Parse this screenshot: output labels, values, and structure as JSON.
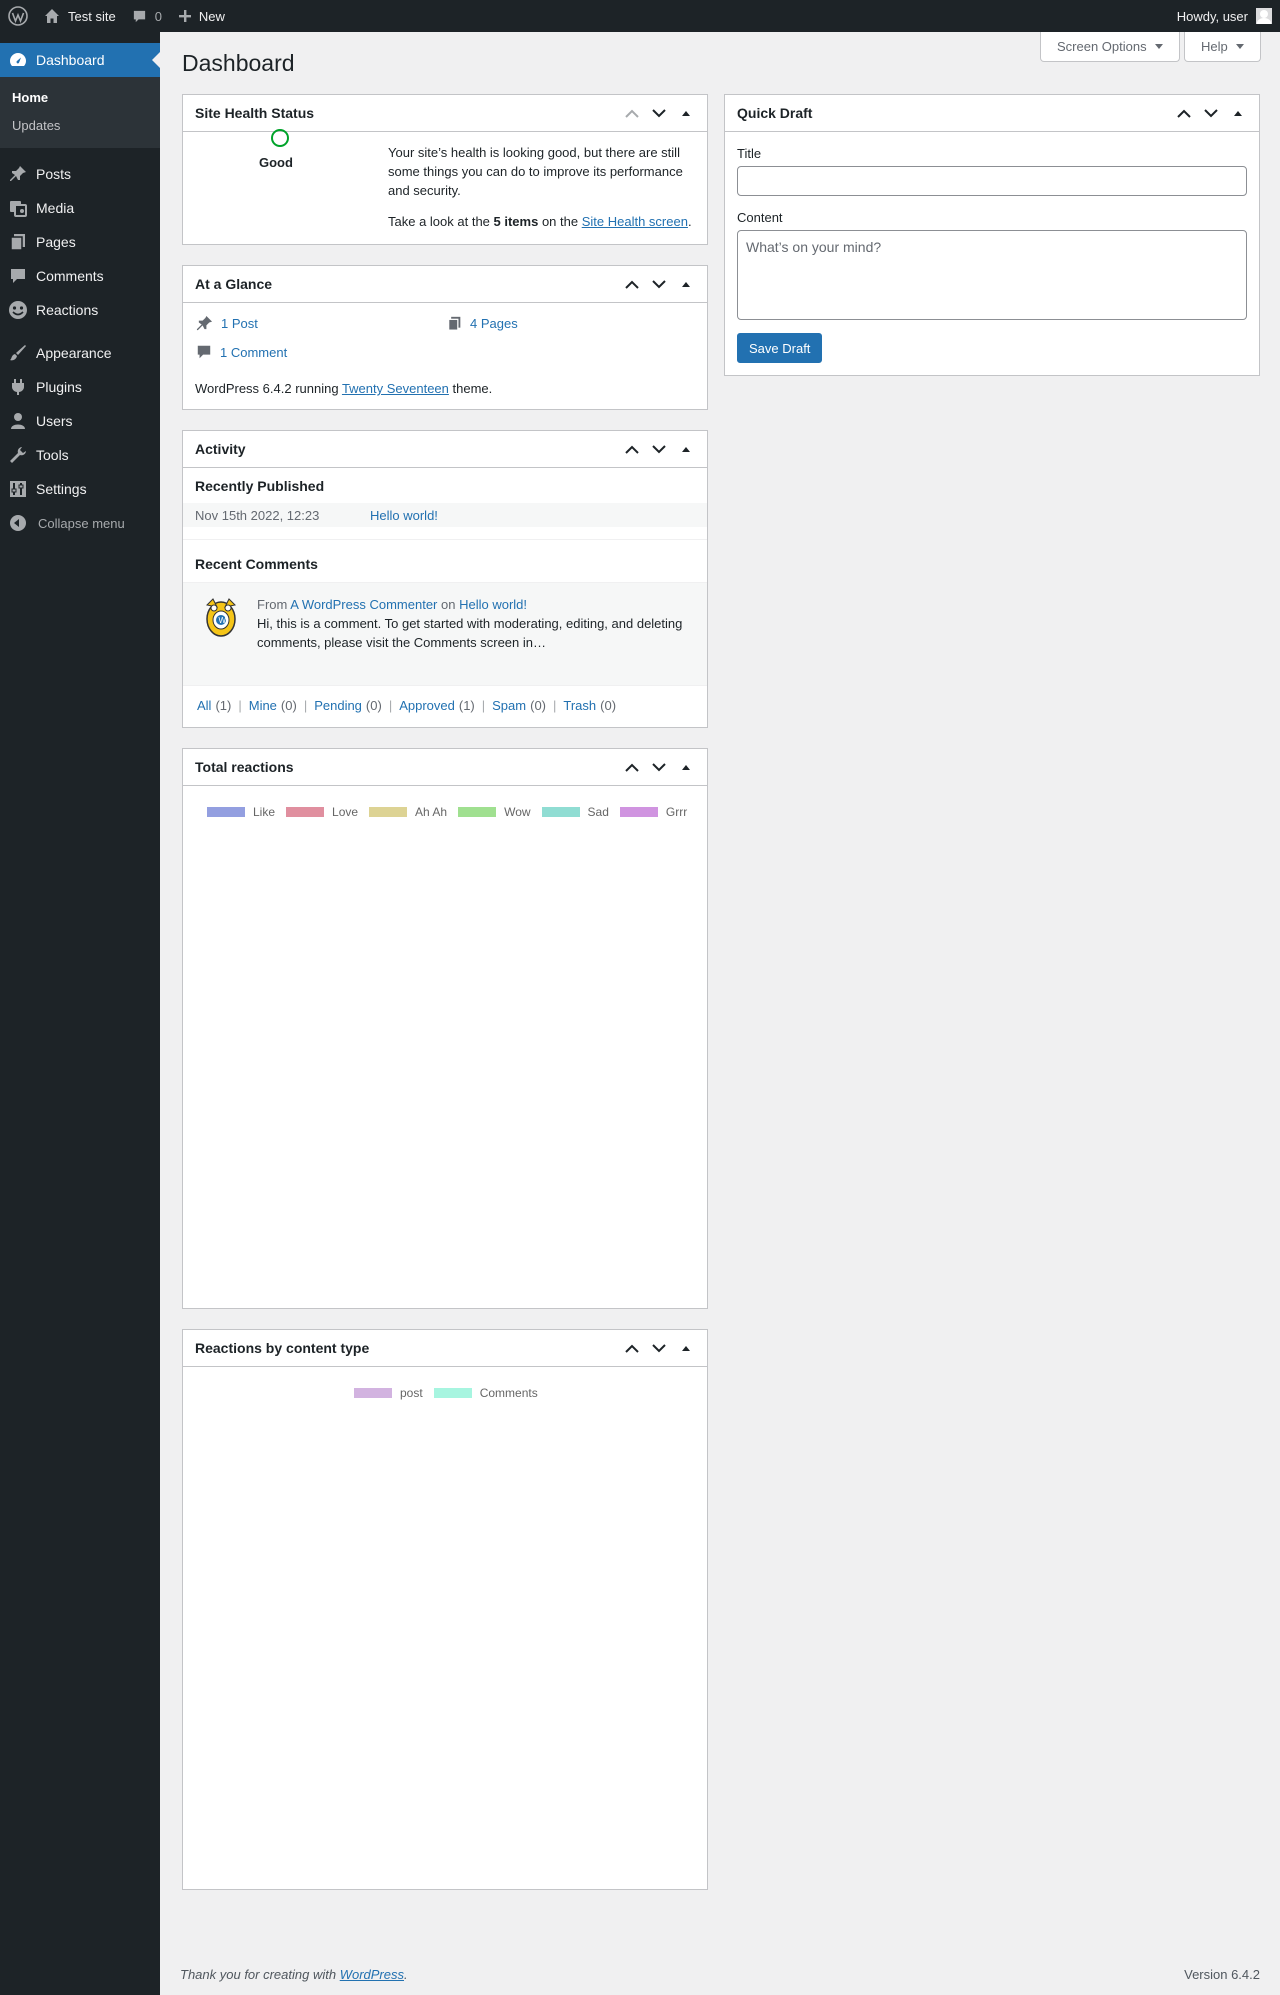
{
  "adminbar": {
    "site_name": "Test site",
    "comment_count": "0",
    "new_label": "New",
    "howdy": "Howdy, user"
  },
  "sidebar": {
    "dashboard": "Dashboard",
    "submenu": [
      "Home",
      "Updates"
    ],
    "items": [
      "Posts",
      "Media",
      "Pages",
      "Comments",
      "Reactions",
      "Appearance",
      "Plugins",
      "Users",
      "Tools",
      "Settings"
    ],
    "collapse": "Collapse menu"
  },
  "header": {
    "title": "Dashboard",
    "screen_options": "Screen Options",
    "help": "Help"
  },
  "site_health": {
    "title": "Site Health Status",
    "status": "Good",
    "text": "Your site’s health is looking good, but there are still some things you can do to improve its performance and security.",
    "look_prefix": "Take a look at the ",
    "items": "5 items",
    "look_mid": " on the ",
    "link": "Site Health screen",
    "look_suffix": "."
  },
  "glance": {
    "title": "At a Glance",
    "posts": "1 Post",
    "pages": "4 Pages",
    "comments": "1 Comment",
    "footer_prefix": "WordPress 6.4.2 running ",
    "theme": "Twenty Seventeen",
    "footer_suffix": " theme."
  },
  "activity": {
    "title": "Activity",
    "recently_published": "Recently Published",
    "pub_date": "Nov 15th 2022, 12:23",
    "pub_title": "Hello world!",
    "recent_comments": "Recent Comments",
    "from": "From",
    "commenter": "A WordPress Commenter",
    "on": "on",
    "post_link": "Hello world!",
    "comment_text": "Hi, this is a comment. To get started with moderating, editing, and deleting comments, please visit the Comments screen in…",
    "filters": [
      {
        "label": "All",
        "count": "(1)"
      },
      {
        "label": "Mine",
        "count": "(0)"
      },
      {
        "label": "Pending",
        "count": "(0)"
      },
      {
        "label": "Approved",
        "count": "(1)"
      },
      {
        "label": "Spam",
        "count": "(0)"
      },
      {
        "label": "Trash",
        "count": "(0)"
      }
    ]
  },
  "total_reactions": {
    "title": "Total reactions",
    "legend": [
      {
        "label": "Like",
        "color": "#939fe0"
      },
      {
        "label": "Love",
        "color": "#e08f9f"
      },
      {
        "label": "Ah Ah",
        "color": "#ddd394"
      },
      {
        "label": "Wow",
        "color": "#a0e090"
      },
      {
        "label": "Sad",
        "color": "#90ddd3"
      },
      {
        "label": "Grrr",
        "color": "#d094e0"
      }
    ]
  },
  "reactions_by_type": {
    "title": "Reactions by content type",
    "legend": [
      {
        "label": "post",
        "color": "#d2b3e0"
      },
      {
        "label": "Comments",
        "color": "#a7f5e0"
      }
    ]
  },
  "quick_draft": {
    "title": "Quick Draft",
    "title_label": "Title",
    "title_value": "",
    "content_label": "Content",
    "content_placeholder": "What’s on your mind?",
    "save": "Save Draft"
  },
  "footer": {
    "thanks_prefix": "Thank you for creating with ",
    "wp_link": "WordPress",
    "thanks_suffix": ".",
    "version": "Version 6.4.2"
  }
}
